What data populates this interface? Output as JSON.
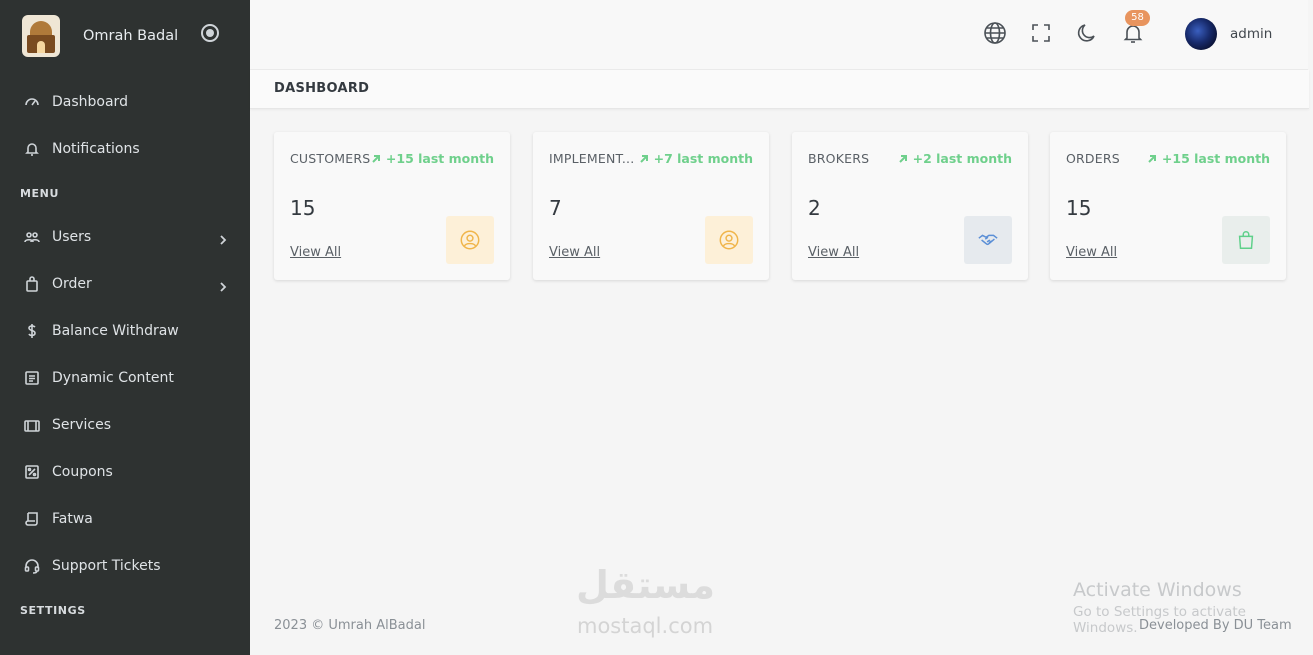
{
  "brand": {
    "name": "Omrah Badal"
  },
  "sidebar": {
    "items": [
      {
        "label": "Dashboard",
        "icon": "dashboard-icon"
      },
      {
        "label": "Notifications",
        "icon": "bell-icon"
      }
    ],
    "menu_title": "MENU",
    "menu_items": [
      {
        "label": "Users",
        "icon": "users-icon",
        "has_submenu": true
      },
      {
        "label": "Order",
        "icon": "shopping-bag-icon",
        "has_submenu": true
      },
      {
        "label": "Balance Withdraw",
        "icon": "dollar-icon",
        "has_submenu": false
      },
      {
        "label": "Dynamic Content",
        "icon": "content-icon",
        "has_submenu": false
      },
      {
        "label": "Services",
        "icon": "briefcase-icon",
        "has_submenu": false
      },
      {
        "label": "Coupons",
        "icon": "percent-icon",
        "has_submenu": false
      },
      {
        "label": "Fatwa",
        "icon": "scroll-icon",
        "has_submenu": false
      },
      {
        "label": "Support Tickets",
        "icon": "headset-icon",
        "has_submenu": false
      }
    ],
    "settings_title": "SETTINGS"
  },
  "topbar": {
    "notification_count": "58",
    "username": "admin",
    "icons": [
      "globe-icon",
      "fullscreen-icon",
      "moon-icon",
      "bell-icon"
    ]
  },
  "page": {
    "title": "DASHBOARD"
  },
  "cards": [
    {
      "title": "CUSTOMERS",
      "trend": "+15 last month",
      "value": "15",
      "link": "View All",
      "icon": "user-circle-icon",
      "icon_bg": "#fdf0d8",
      "icon_color": "#f0b54a"
    },
    {
      "title": "IMPLEMENT...",
      "trend": "+7 last month",
      "value": "7",
      "link": "View All",
      "icon": "user-circle-icon",
      "icon_bg": "#fdf0d8",
      "icon_color": "#f0b54a"
    },
    {
      "title": "BROKERS",
      "trend": "+2 last month",
      "value": "2",
      "link": "View All",
      "icon": "handshake-icon",
      "icon_bg": "#e6eaee",
      "icon_color": "#5b8fd6"
    },
    {
      "title": "ORDERS",
      "trend": "+15 last month",
      "value": "15",
      "link": "View All",
      "icon": "shopping-bag-icon",
      "icon_bg": "#e9eeec",
      "icon_color": "#5fd08a"
    }
  ],
  "footer": {
    "copyright": "2023 © Umrah AlBadal",
    "credit": "Developed By DU Team"
  },
  "watermark": {
    "logo_text": "مستقل",
    "url": "mostaql.com"
  },
  "activation": {
    "title": "Activate Windows",
    "subtitle": "Go to Settings to activate Windows."
  },
  "colors": {
    "sidebar_bg": "#2e3231",
    "trend_green": "#6fd08c",
    "badge_orange": "#e8945e"
  }
}
